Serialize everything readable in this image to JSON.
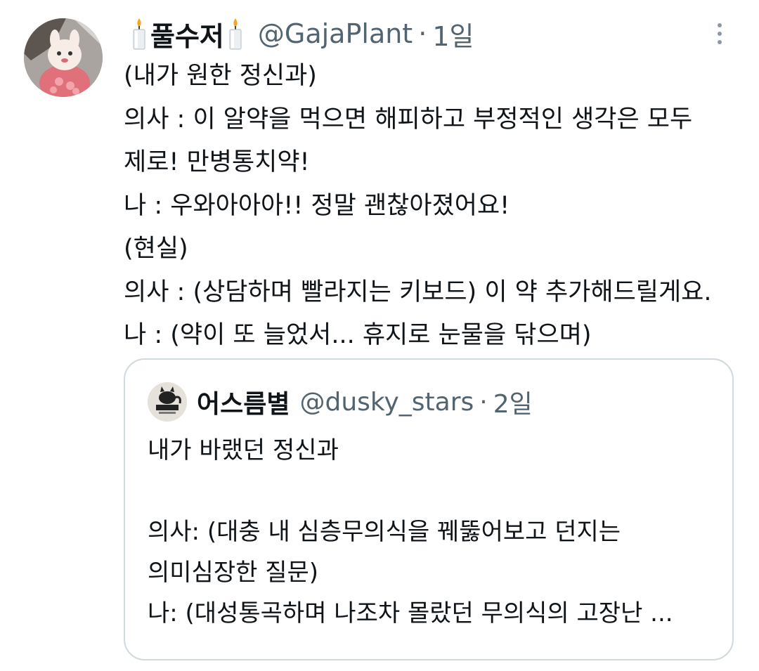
{
  "tweet": {
    "author": {
      "name": "풀수저",
      "handle": "@GajaPlant",
      "avatar_icon": "avatar-image"
    },
    "separator": "·",
    "time": "1일",
    "more_icon": "more-vertical-icon",
    "name_icon": "candle-icon",
    "lines": [
      "(내가 원한 정신과)",
      "의사 : 이 알약을 먹으면 해피하고 부정적인 생각은 모두",
      "제로! 만병통치약!",
      "나 : 우와아아아!! 정말 괜찮아졌어요!",
      "(현실)",
      "의사 : (상담하며 빨라지는 키보드) 이 약 추가해드릴게요.",
      "나 : (약이 또 늘었서... 휴지로 눈물을 닦으며)"
    ]
  },
  "quoted": {
    "author": {
      "name": "어스름별",
      "handle": "@dusky_stars",
      "avatar_icon": "avatar-image"
    },
    "separator": "·",
    "time": "2일",
    "lines": [
      "내가 바랬던 정신과",
      "",
      "의사: (대충 내 심층무의식을 꿰뚫어보고 던지는",
      "의미심장한 질문)",
      "나: (대성통곡하며 나조차 몰랐던 무의식의 고장난 ..."
    ]
  },
  "colors": {
    "text": "#0f1419",
    "secondary": "#536471",
    "border": "#cfd9de"
  }
}
